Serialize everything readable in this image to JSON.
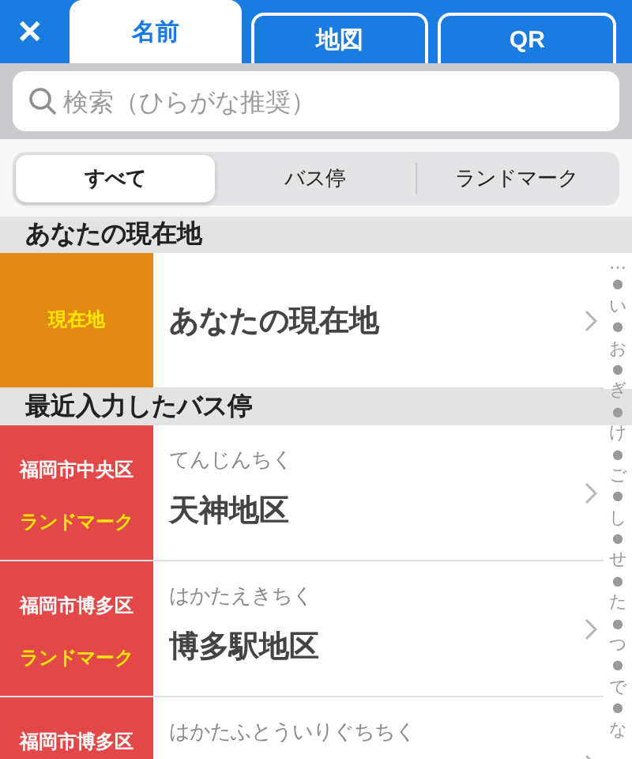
{
  "close_button": {
    "label": "✕"
  },
  "tabs": [
    {
      "label": "名前",
      "selected": true
    },
    {
      "label": "地図",
      "selected": false
    },
    {
      "label": "QR",
      "selected": false
    }
  ],
  "search": {
    "placeholder": "検索（ひらがな推奨）"
  },
  "filters": [
    {
      "label": "すべて",
      "selected": true
    },
    {
      "label": "バス停",
      "selected": false
    },
    {
      "label": "ランドマーク",
      "selected": false
    }
  ],
  "sections": [
    {
      "title": "あなたの現在地",
      "rows": [
        {
          "kind": "current",
          "color": "#e38a14",
          "badge": "現在地",
          "title": "あなたの現在地"
        }
      ]
    },
    {
      "title": "最近入力したバス停",
      "rows": [
        {
          "kind": "stop",
          "color": "#e24848",
          "area": "福岡市中央区",
          "badge": "ランドマーク",
          "reading": "てんじんちく",
          "title": "天神地区"
        },
        {
          "kind": "stop",
          "color": "#e24848",
          "area": "福岡市博多区",
          "badge": "ランドマーク",
          "reading": "はかたえきちく",
          "title": "博多駅地区"
        },
        {
          "kind": "stop",
          "color": "#e24848",
          "area": "福岡市博多区",
          "reading": "はかたふとういりぐちちく"
        }
      ]
    }
  ],
  "index": [
    "…",
    "●",
    "い",
    "●",
    "お",
    "●",
    "ぎ",
    "●",
    "け",
    "●",
    "ご",
    "●",
    "し",
    "●",
    "せ",
    "●",
    "た",
    "●",
    "つ",
    "●",
    "で",
    "●",
    "な"
  ]
}
